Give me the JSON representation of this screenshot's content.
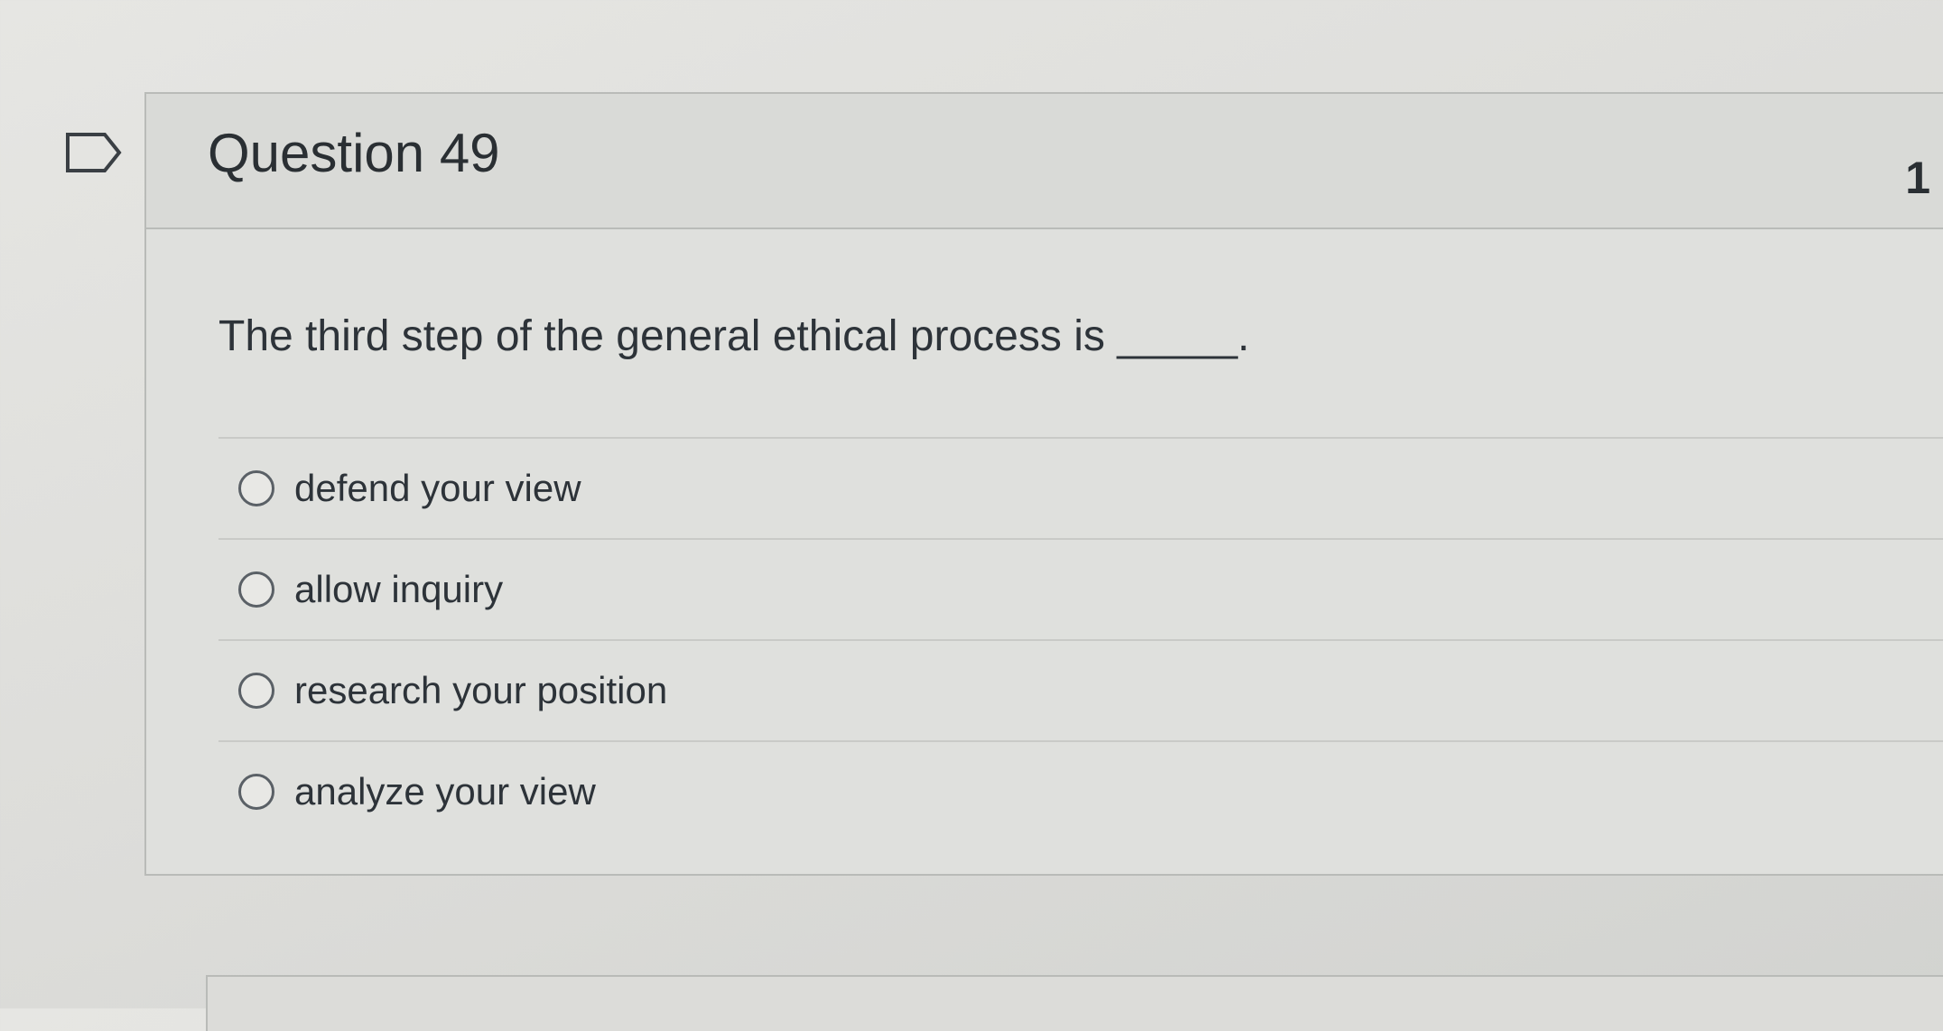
{
  "question": {
    "title": "Question 49",
    "points": "1",
    "text": "The third step of the general ethical process is _____.",
    "answers": [
      {
        "label": "defend your view"
      },
      {
        "label": "allow inquiry"
      },
      {
        "label": "research your position"
      },
      {
        "label": "analyze your view"
      }
    ]
  },
  "icons": {
    "flag": "flag-question-icon"
  }
}
